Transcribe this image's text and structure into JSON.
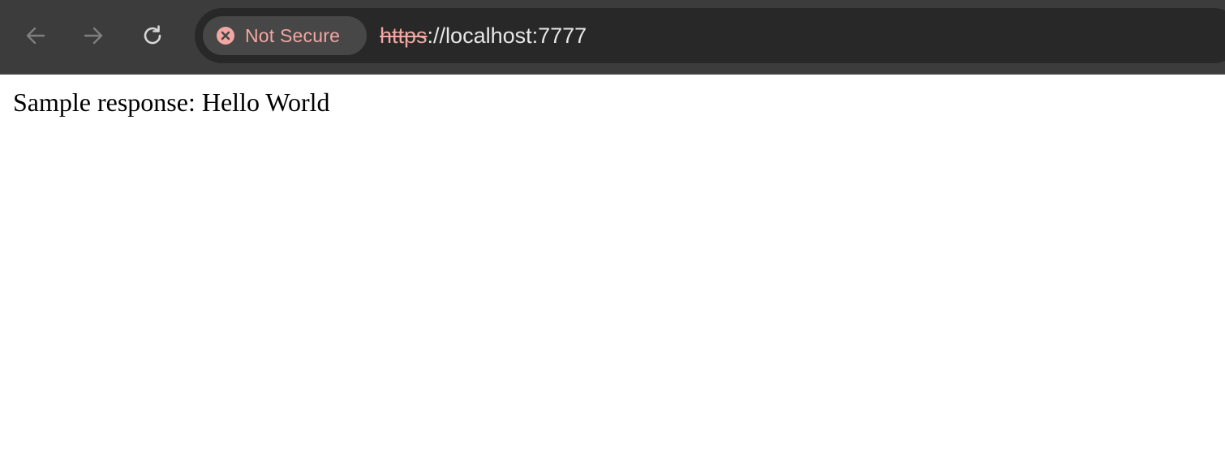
{
  "browser": {
    "nav": {
      "back_icon": "arrow-left-icon",
      "forward_icon": "arrow-right-icon",
      "reload_icon": "reload-icon"
    },
    "omnibox": {
      "security_icon": "x-circle-icon",
      "security_label": "Not Secure",
      "url_scheme": "https",
      "url_rest": "://localhost:7777"
    }
  },
  "page": {
    "body_text": "Sample response: Hello World"
  },
  "colors": {
    "toolbar_bg": "#3c3c3c",
    "omnibox_bg": "#282828",
    "security_chip_bg": "#474747",
    "not_secure_red": "#f2a7a2",
    "url_text": "#e8e8e8",
    "page_bg": "#ffffff"
  }
}
